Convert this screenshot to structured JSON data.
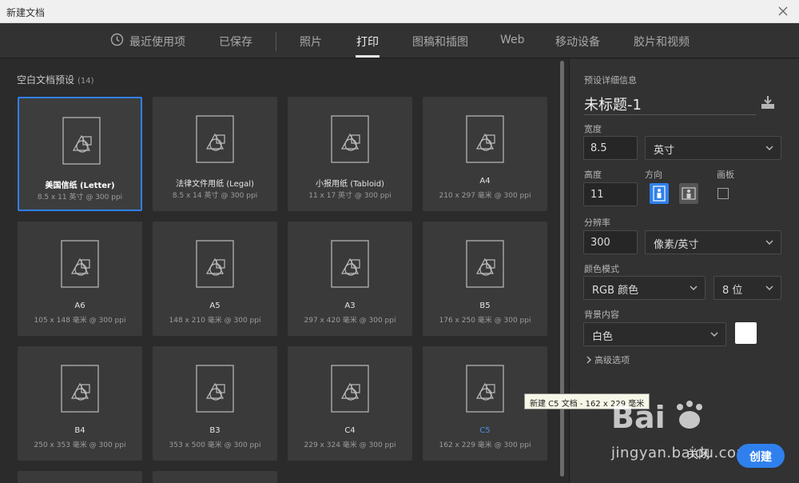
{
  "window": {
    "title": "新建文档"
  },
  "tabs": [
    {
      "label": "最近使用项"
    },
    {
      "label": "已保存"
    },
    {
      "label": "照片"
    },
    {
      "label": "打印"
    },
    {
      "label": "图稿和插图"
    },
    {
      "label": "Web"
    },
    {
      "label": "移动设备"
    },
    {
      "label": "胶片和视频"
    }
  ],
  "presets": {
    "title": "空白文档预设",
    "count": "(14)",
    "items": [
      {
        "name": "美国信纸 (Letter)",
        "size": "8.5 x 11 英寸 @ 300 ppi"
      },
      {
        "name": "法律文件用纸 (Legal)",
        "size": "8.5 x 14 英寸 @ 300 ppi"
      },
      {
        "name": "小报用纸 (Tabloid)",
        "size": "11 x 17 英寸 @ 300 ppi"
      },
      {
        "name": "A4",
        "size": "210 x 297 毫米 @ 300 ppi"
      },
      {
        "name": "A6",
        "size": "105 x 148 毫米 @ 300 ppi"
      },
      {
        "name": "A5",
        "size": "148 x 210 毫米 @ 300 ppi"
      },
      {
        "name": "A3",
        "size": "297 x 420 毫米 @ 300 ppi"
      },
      {
        "name": "B5",
        "size": "176 x 250 毫米 @ 300 ppi"
      },
      {
        "name": "B4",
        "size": "250 x 353 毫米 @ 300 ppi"
      },
      {
        "name": "B3",
        "size": "353 x 500 毫米 @ 300 ppi"
      },
      {
        "name": "C4",
        "size": "229 x 324 毫米 @ 300 ppi"
      },
      {
        "name": "C5",
        "size": "162 x 229 毫米 @ 300 ppi"
      }
    ]
  },
  "details": {
    "heading": "预设详细信息",
    "doc_title": "未标题-1",
    "width_label": "宽度",
    "width_value": "8.5",
    "width_unit": "英寸",
    "height_label": "高度",
    "height_value": "11",
    "orientation_label": "方向",
    "artboard_label": "画板",
    "resolution_label": "分辨率",
    "resolution_value": "300",
    "resolution_unit": "像素/英寸",
    "color_mode_label": "颜色模式",
    "color_mode_value": "RGB 颜色",
    "bit_depth_value": "8 位",
    "background_label": "背景内容",
    "background_value": "白色",
    "advanced_label": "高级选项"
  },
  "tooltip": {
    "text": "新建 C5 文档 - 162 x 229 毫米"
  },
  "actions": {
    "close_label": "关闭",
    "create_label": "创建"
  },
  "watermark": {
    "url": "jingyan.baidu.com"
  },
  "colors": {
    "accent": "#2f80ed",
    "background_swatch": "#ffffff"
  }
}
